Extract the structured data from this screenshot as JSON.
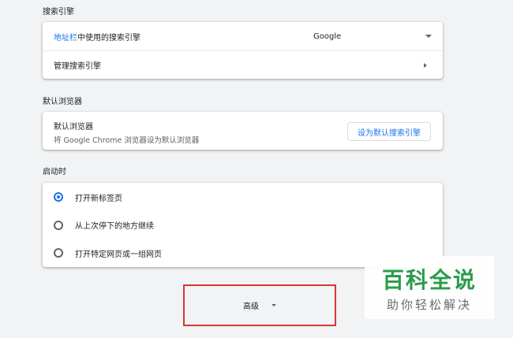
{
  "search_engine": {
    "section_title": "搜索引擎",
    "row1_link": "地址栏",
    "row1_rest": "中使用的搜索引擎",
    "selected_engine": "Google",
    "row2_label": "管理搜索引擎"
  },
  "default_browser": {
    "section_title": "默认浏览器",
    "title": "默认浏览器",
    "description": "将 Google Chrome 浏览器设为默认浏览器",
    "button_label": "设为默认搜索引擎"
  },
  "startup": {
    "section_title": "启动时",
    "options": [
      {
        "label": "打开新标签页",
        "checked": true
      },
      {
        "label": "从上次停下的地方继续",
        "checked": false
      },
      {
        "label": "打开特定网页或一组网页",
        "checked": false
      }
    ]
  },
  "advanced": {
    "label": "高级"
  },
  "watermark": {
    "big": "百科全说",
    "small": "助你轻松解决"
  },
  "colors": {
    "accent": "#1a73e8",
    "highlight_box": "#d93636",
    "watermark_green": "#2a9d4a"
  }
}
